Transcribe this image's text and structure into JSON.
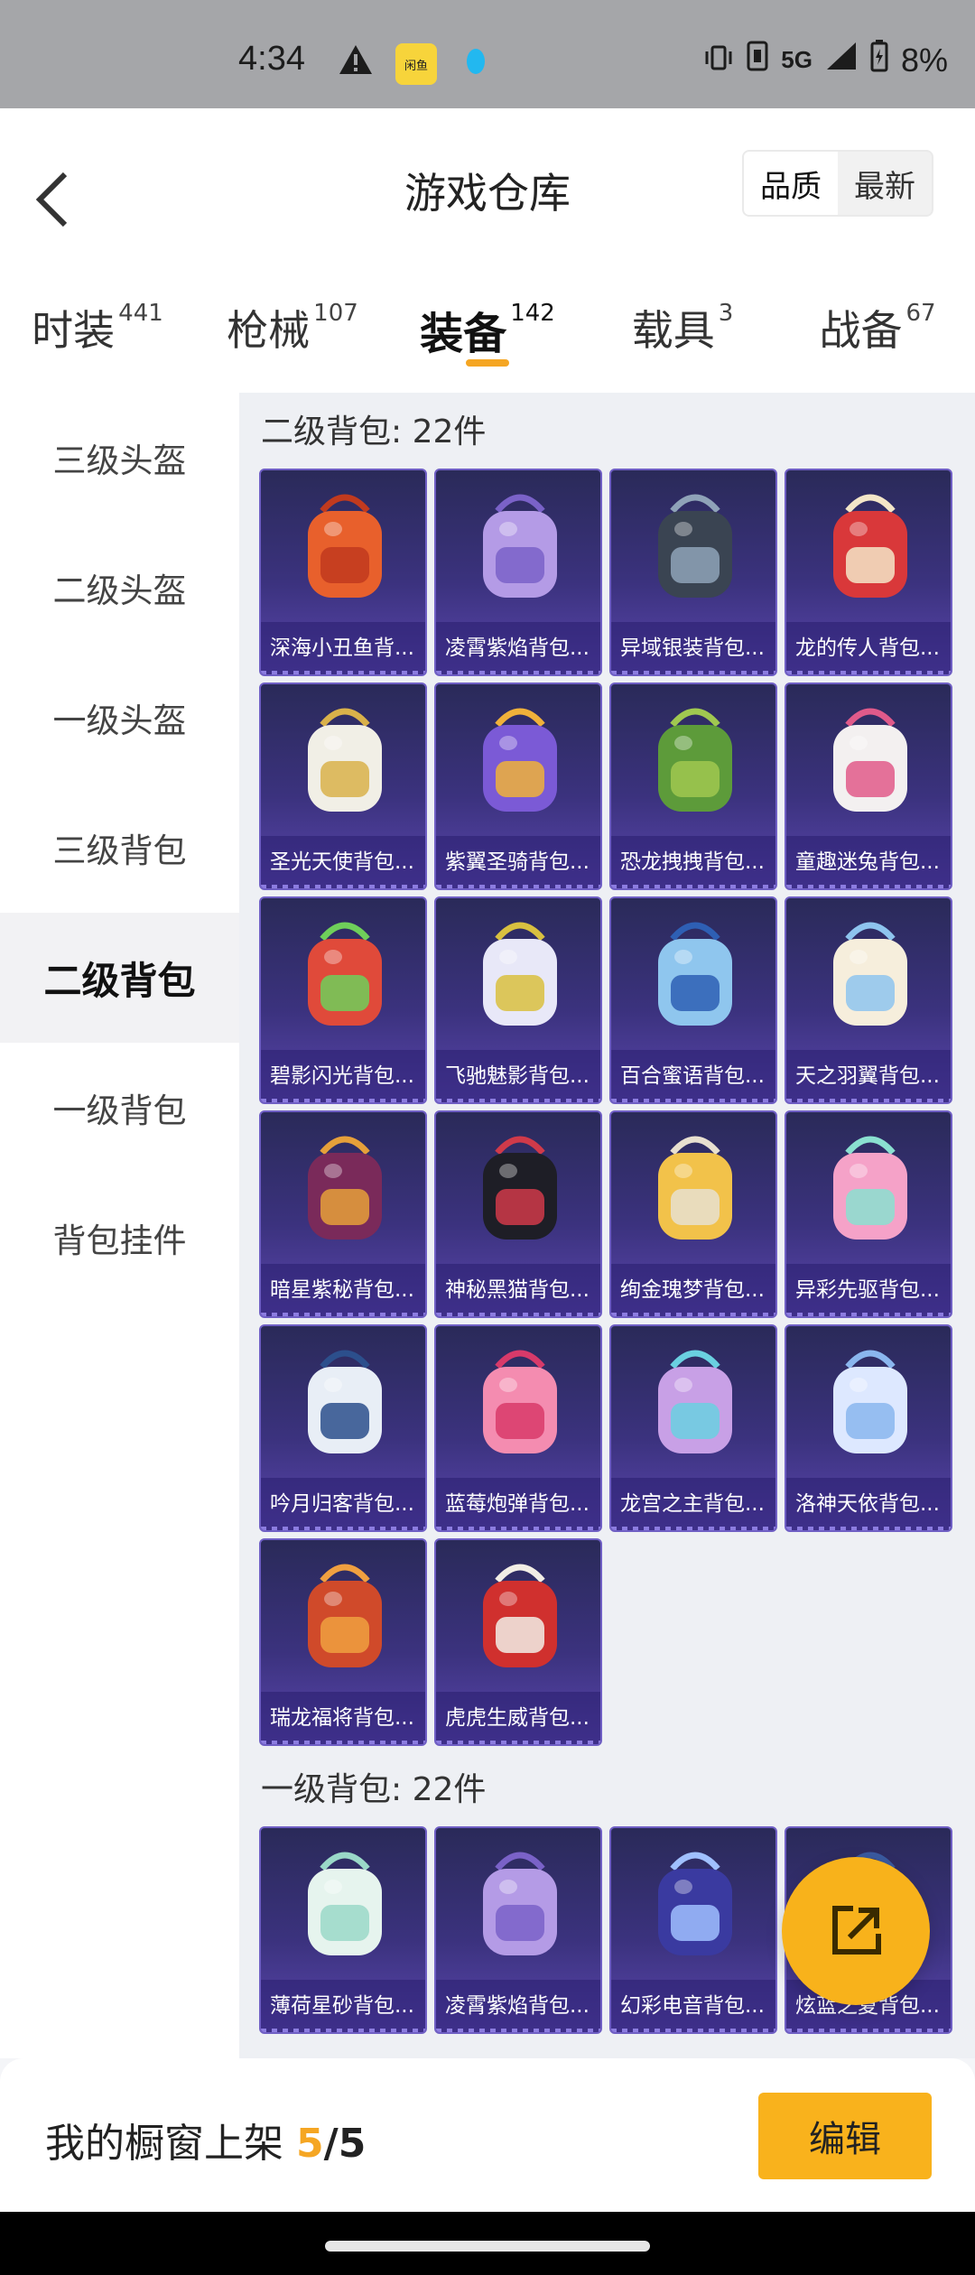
{
  "status_bar": {
    "time": "4:34",
    "app_badge": "闲鱼",
    "network": "5G",
    "battery": "8%"
  },
  "header": {
    "title": "游戏仓库",
    "sort": [
      "品质",
      "最新"
    ],
    "sort_selected": "品质"
  },
  "tabs": [
    {
      "label": "时装",
      "count": "441"
    },
    {
      "label": "枪械",
      "count": "107"
    },
    {
      "label": "装备",
      "count": "142"
    },
    {
      "label": "载具",
      "count": "3"
    },
    {
      "label": "战备",
      "count": "67"
    }
  ],
  "active_tab": "装备",
  "sidebar": {
    "items": [
      "三级头盔",
      "二级头盔",
      "一级头盔",
      "三级背包",
      "二级背包",
      "一级背包",
      "背包挂件"
    ],
    "active": "二级背包"
  },
  "sections": [
    {
      "title": "二级背包: 22件",
      "items": [
        "深海小丑鱼背...",
        "凌霄紫焰背包...",
        "异域银装背包...",
        "龙的传人背包...",
        "圣光天使背包...",
        "紫翼圣骑背包...",
        "恐龙拽拽背包...",
        "童趣迷兔背包...",
        "碧影闪光背包...",
        "飞驰魅影背包...",
        "百合蜜语背包...",
        "天之羽翼背包...",
        "暗星紫秘背包...",
        "神秘黑猫背包...",
        "绚金瑰梦背包...",
        "异彩先驱背包...",
        "吟月归客背包...",
        "蓝莓炮弹背包...",
        "龙宫之主背包...",
        "洛神天依背包...",
        "瑞龙福将背包...",
        "虎虎生威背包..."
      ]
    },
    {
      "title": "一级背包: 22件",
      "items": [
        "薄荷星砂背包...",
        "凌霄紫焰背包...",
        "幻彩电音背包...",
        "炫蓝之夏背包..."
      ]
    }
  ],
  "bottom_bar": {
    "label": "我的橱窗上架",
    "current": "5",
    "total": "/5",
    "edit_label": "编辑"
  },
  "colors": {
    "accent": "#f5a623",
    "card_bg": "#3b327e"
  }
}
